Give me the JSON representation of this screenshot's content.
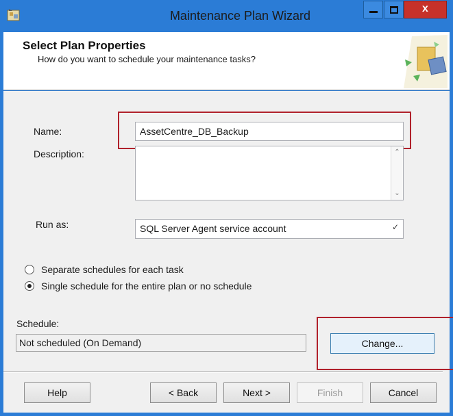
{
  "window": {
    "title": "Maintenance Plan Wizard"
  },
  "header": {
    "title": "Select Plan Properties",
    "subtitle": "How do you want to schedule your maintenance tasks?"
  },
  "form": {
    "name_label": "Name:",
    "name_value": "AssetCentre_DB_Backup",
    "description_label": "Description:",
    "description_value": "",
    "run_as_label": "Run as:",
    "run_as_value": "SQL Server Agent service account"
  },
  "schedule_options": [
    {
      "label": "Separate schedules for each task",
      "selected": false
    },
    {
      "label": "Single schedule for the entire plan or no schedule",
      "selected": true
    }
  ],
  "schedule": {
    "label": "Schedule:",
    "value": "Not scheduled (On Demand)",
    "change_label": "Change..."
  },
  "buttons": {
    "help": "Help",
    "back": "< Back",
    "next": "Next >",
    "finish": "Finish",
    "cancel": "Cancel"
  },
  "colors": {
    "titlebar": "#2b7cd6",
    "highlight": "#b0212b",
    "close": "#c7312a"
  }
}
